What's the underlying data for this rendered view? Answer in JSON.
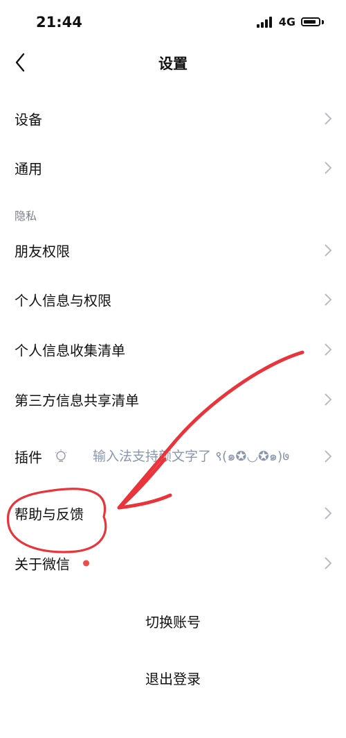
{
  "status": {
    "time": "21:44",
    "network": "4G"
  },
  "nav": {
    "title": "设置"
  },
  "settings": {
    "device": "设备",
    "general": "通用",
    "privacy_header": "隐私",
    "friend_permissions": "朋友权限",
    "personal_info_permissions": "个人信息与权限",
    "personal_info_collection": "个人信息收集清单",
    "third_party_sharing": "第三方信息共享清单",
    "plugins": "插件",
    "plugin_status": "输入法支持颜文字了 ९(๑✪◡✪๑)७",
    "help_feedback": "帮助与反馈",
    "about_wechat": "关于微信"
  },
  "actions": {
    "switch_account": "切换账号",
    "logout": "退出登录"
  },
  "colors": {
    "annotation": "#e8343a",
    "secondary_text": "#7a7f88",
    "chevron": "#b8bcc4"
  }
}
